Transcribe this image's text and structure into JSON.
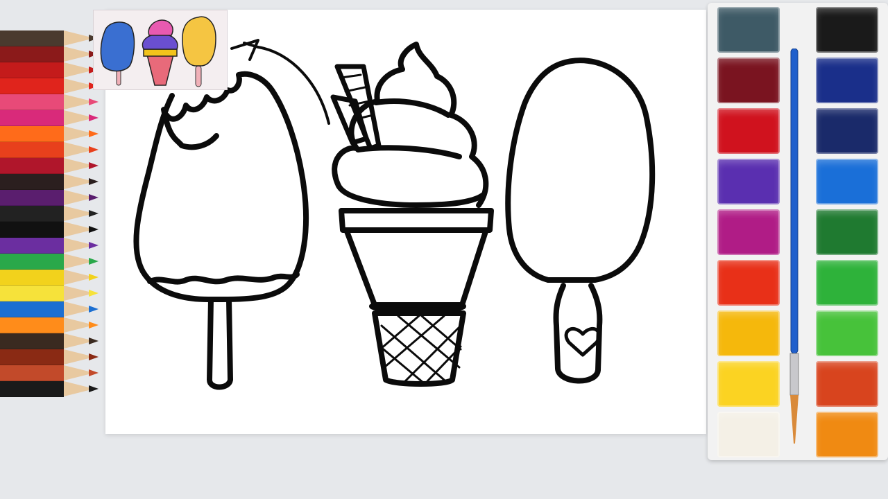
{
  "scene": {
    "description_hidden": "",
    "pencils": {
      "colors": [
        "#4a3a2e",
        "#8b1a1a",
        "#c41b1b",
        "#e0241c",
        "#e84a78",
        "#d92a7a",
        "#ff6b1a",
        "#e8401c",
        "#b0162b",
        "#2b1f1f",
        "#5a1e6e",
        "#222222",
        "#111111",
        "#6b2ea0",
        "#2aa84a",
        "#f2d21c",
        "#f6e23a",
        "#1c6fd1",
        "#ff8c1a",
        "#3a2a20",
        "#8a2a14",
        "#c24a2a",
        "#1a1a1a"
      ]
    },
    "palette": {
      "left_pans": [
        "#3e5a66",
        "#7a1420",
        "#d0121e",
        "#5a2fb0",
        "#b01c86",
        "#e83018",
        "#f5b80c",
        "#fbd322",
        "#f4f0e6"
      ],
      "right_pans": [
        "#1a1a1a",
        "#1a2f8a",
        "#1a2a6a",
        "#1a6fd8",
        "#1f7a30",
        "#2eb23a",
        "#47c23a",
        "#d8441e",
        "#f08a12"
      ]
    },
    "thumbnail": {
      "colors": {
        "popsicle_left": "#3a6fd1",
        "cone_scoop_top": "#e85ab0",
        "cone_scoop_mid": "#6a4fd0",
        "cone_band": "#f2c31c",
        "cone": "#e86a7a",
        "popsicle_right": "#f5c542",
        "stick": "#f0b0b8"
      }
    },
    "accent": {
      "ink": "#0b0b0b",
      "paper": "#ffffff"
    }
  }
}
